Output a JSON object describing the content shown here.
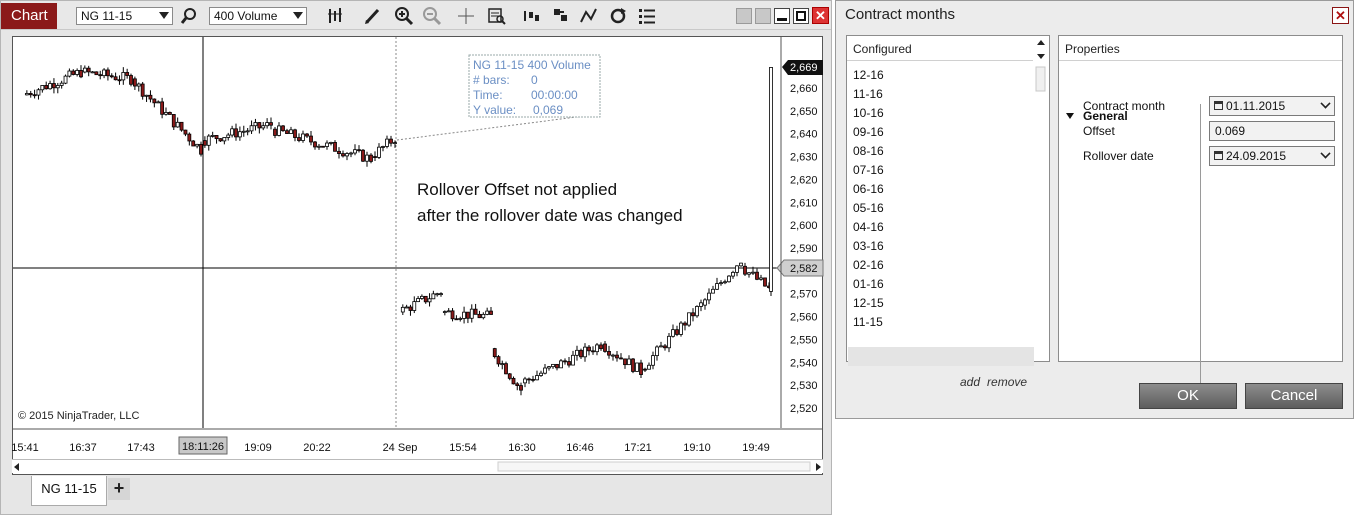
{
  "chart_window": {
    "tab_label": "Chart",
    "instrument_selected": "NG 11-15",
    "interval_selected": "400 Volume",
    "close_glyph": "✕",
    "copyright": "© 2015 NinjaTrader, LLC",
    "bottom_tab": "NG 11-15",
    "add_tab_glyph": "+",
    "icons": [
      "search-icon",
      "bar-style-icon",
      "pencil-icon",
      "zoom-in-icon",
      "zoom-out-icon",
      "crosshair-icon",
      "data-box-icon",
      "indicators-icon",
      "strategies-icon",
      "drawing-tools-icon",
      "refresh-icon",
      "properties-icon"
    ]
  },
  "annotation": {
    "line1": "Rollover Offset not applied",
    "line2": "after the rollover date was changed"
  },
  "data_box": {
    "header": "NG 11-15 400 Volume",
    "bars_label": "# bars:",
    "bars_value": "0",
    "time_label": "Time:",
    "time_value": "00:00:00",
    "y_label": "Y value:",
    "y_value": "0,069"
  },
  "chart_data": {
    "type": "candlestick",
    "y_ticks": [
      "2,660",
      "2,650",
      "2,640",
      "2,630",
      "2,620",
      "2,610",
      "2,600",
      "2,590",
      "2,580",
      "2,570",
      "2,560",
      "2,550",
      "2,540",
      "2,530",
      "2,520"
    ],
    "x_ticks": [
      "15:41",
      "16:37",
      "17:43",
      "18:11:26",
      "19:09",
      "20:22",
      "24 Sep",
      "15:54",
      "16:30",
      "16:46",
      "17:21",
      "19:10",
      "19:49"
    ],
    "price_marker_last": "2,669",
    "price_marker_crosshair": "2,582",
    "time_marker_crosshair": "18:11:26",
    "ylim": [
      2515,
      2673
    ],
    "colors": {
      "up": "#ffffff",
      "down": "#8b1a1a",
      "wick": "#000000"
    }
  },
  "dialog": {
    "title": "Contract months",
    "close_glyph": "✕",
    "configured_header": "Configured",
    "months": [
      "12-16",
      "11-16",
      "10-16",
      "09-16",
      "08-16",
      "07-16",
      "06-16",
      "05-16",
      "04-16",
      "03-16",
      "02-16",
      "01-16",
      "12-15",
      "11-15"
    ],
    "selected_month": "11-15",
    "add_label": "add",
    "remove_label": "remove",
    "properties_header": "Properties",
    "group_label": "General",
    "contract_month_label": "Contract month",
    "contract_month_value": "01.11.2015",
    "offset_label": "Offset",
    "offset_value": "0.069",
    "rollover_date_label": "Rollover date",
    "rollover_date_value": "24.09.2015",
    "ok_label": "OK",
    "cancel_label": "Cancel"
  }
}
